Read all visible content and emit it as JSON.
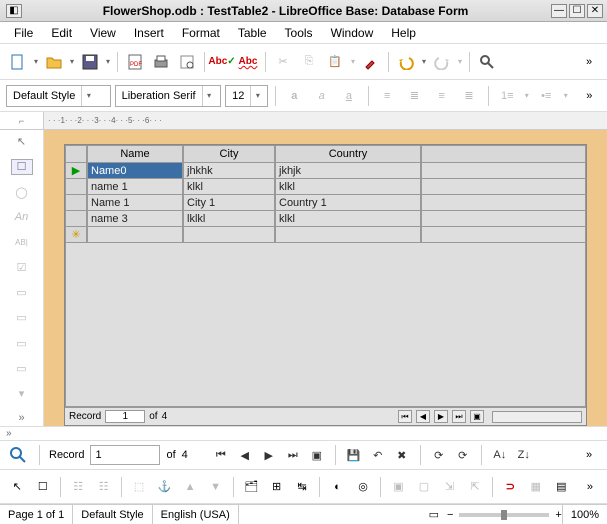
{
  "window": {
    "title": "FlowerShop.odb : TestTable2 - LibreOffice Base: Database Form"
  },
  "menus": [
    "File",
    "Edit",
    "View",
    "Insert",
    "Format",
    "Table",
    "Tools",
    "Window",
    "Help"
  ],
  "style_combo": "Default Style",
  "font_combo": "Liberation Serif",
  "size_combo": "12",
  "grid": {
    "columns": [
      "Name",
      "City",
      "Country"
    ],
    "rows": [
      {
        "marker": "▶",
        "cells": [
          "Name0",
          "jhkhk",
          "jkhjk"
        ],
        "sel": 0
      },
      {
        "marker": "",
        "cells": [
          "name 1",
          "klkl",
          "klkl"
        ]
      },
      {
        "marker": "",
        "cells": [
          "Name 1",
          "City 1",
          "Country 1"
        ]
      },
      {
        "marker": "",
        "cells": [
          "name 3",
          "lklkl",
          "klkl"
        ]
      },
      {
        "marker": "✳",
        "cells": [
          "",
          "",
          ""
        ]
      }
    ]
  },
  "inner_record": {
    "label": "Record",
    "value": "1",
    "of_label": "of",
    "total": "4"
  },
  "outer_record": {
    "label": "Record",
    "value": "1",
    "of_label": "of",
    "total": "4"
  },
  "status": {
    "page": "Page 1 of 1",
    "style": "Default Style",
    "lang": "English (USA)",
    "zoom": "100%"
  }
}
